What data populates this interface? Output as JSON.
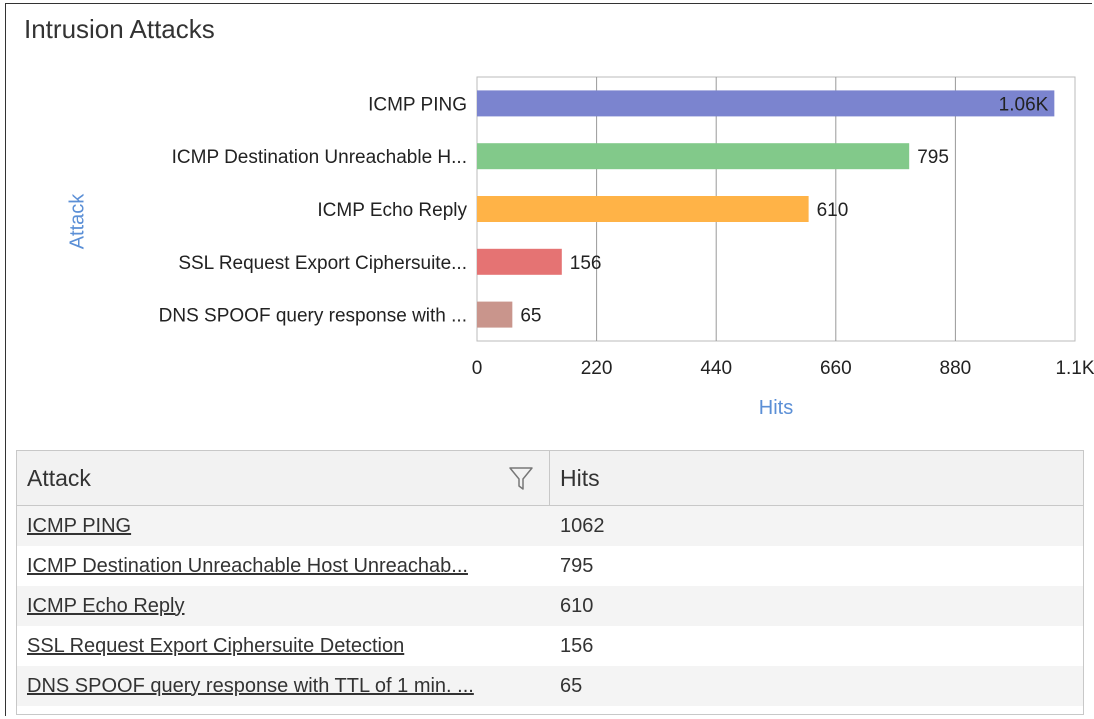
{
  "widget": {
    "title": "Intrusion Attacks"
  },
  "chart_data": {
    "type": "bar",
    "orientation": "horizontal",
    "categories": [
      "ICMP PING",
      "ICMP Destination Unreachable H...",
      "ICMP Echo Reply",
      "SSL Request Export Ciphersuite...",
      "DNS SPOOF query response with ..."
    ],
    "values": [
      1062,
      795,
      610,
      156,
      65
    ],
    "data_labels": [
      "1.06K",
      "795",
      "610",
      "156",
      "65"
    ],
    "colors": [
      "#7b84cf",
      "#82c98a",
      "#ffb347",
      "#e57373",
      "#c9958c"
    ],
    "xlabel": "Hits",
    "ylabel": "Attack",
    "xlim": [
      0,
      1100
    ],
    "xticks": [
      "0",
      "220",
      "440",
      "660",
      "880",
      "1.1K"
    ],
    "grid": true
  },
  "table": {
    "columns": {
      "attack": "Attack",
      "hits": "Hits"
    },
    "rows": [
      {
        "attack": "ICMP PING",
        "hits": "1062"
      },
      {
        "attack": "ICMP Destination Unreachable Host Unreachab...",
        "hits": "795"
      },
      {
        "attack": "ICMP Echo Reply",
        "hits": "610"
      },
      {
        "attack": "SSL Request Export Ciphersuite Detection",
        "hits": "156"
      },
      {
        "attack": "DNS SPOOF query response with TTL of 1 min. ...",
        "hits": "65"
      }
    ]
  },
  "icons": {
    "filter": "filter-icon"
  }
}
